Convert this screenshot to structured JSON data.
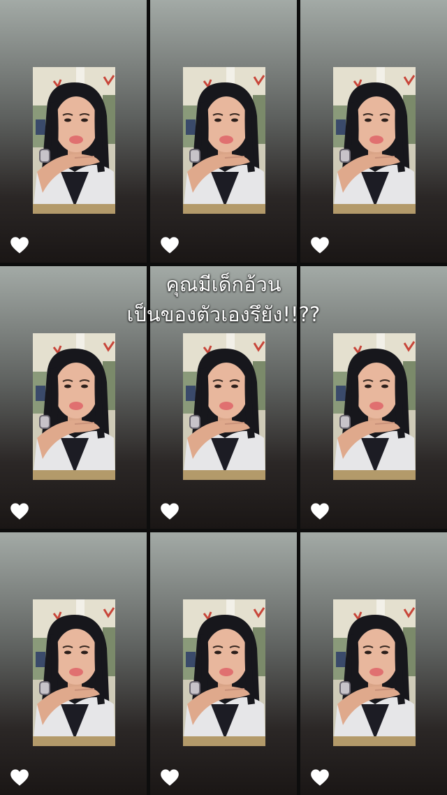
{
  "caption": {
    "line1": "คุณมีเด็กอ้วน",
    "line2": "เป็นของตัวเองรึยัง!!??"
  },
  "tile": {
    "like_icon": "heart-icon",
    "photo": "girl-selfie-photo",
    "count": 9
  },
  "colors": {
    "caption_text": "#ffffff",
    "heart": "#ffffff",
    "divider": "#0d0d0d",
    "lip_accent": "#e07070"
  }
}
